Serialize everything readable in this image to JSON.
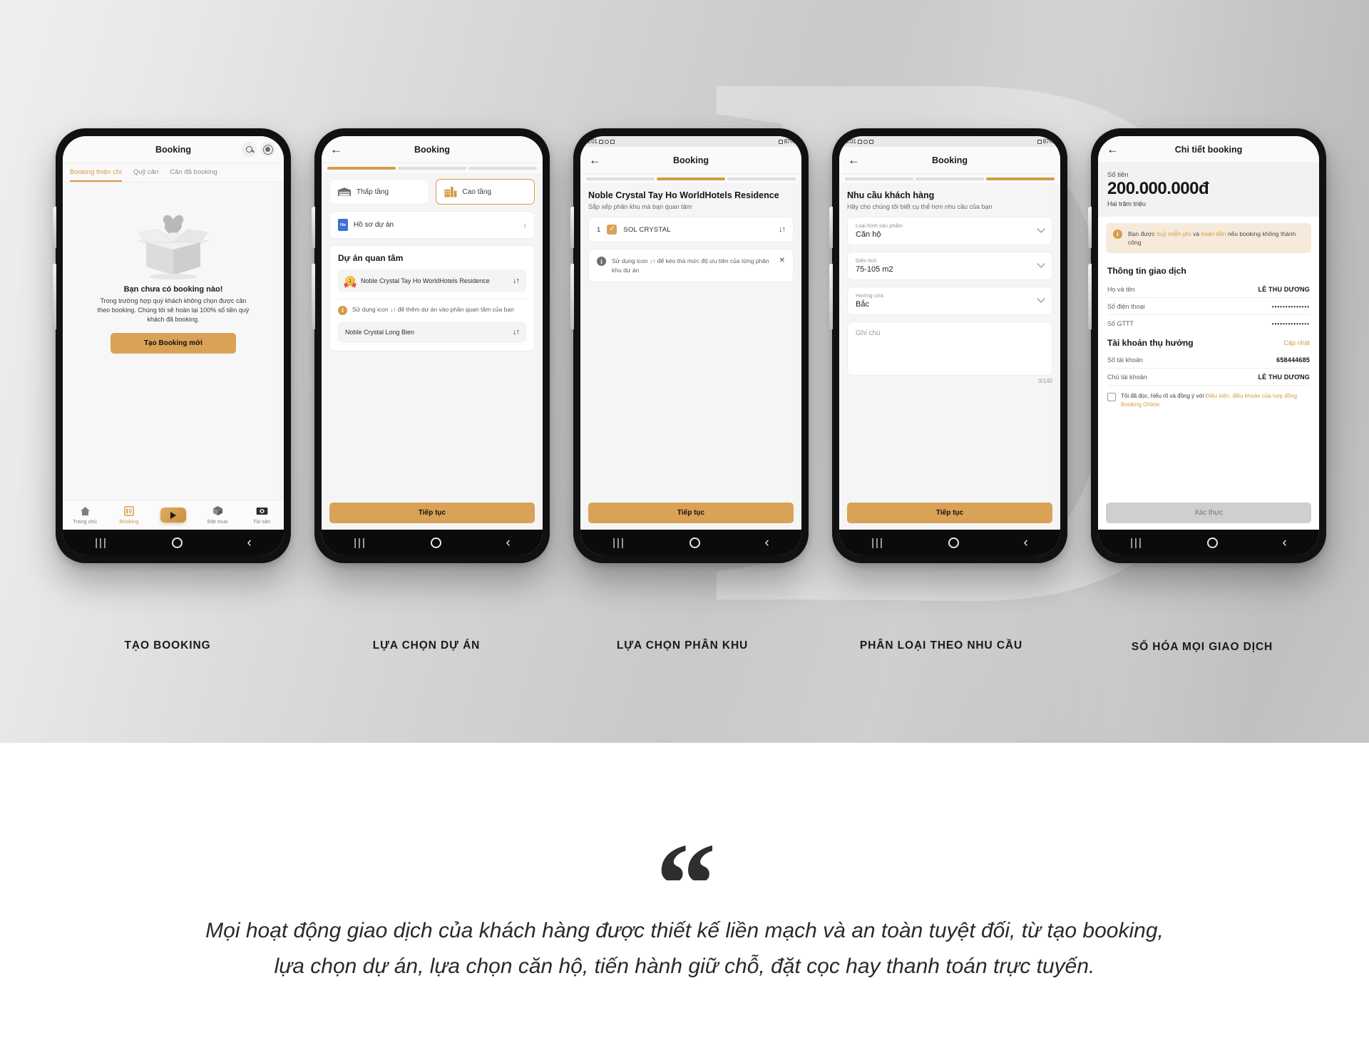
{
  "colors": {
    "accent": "#d79a46",
    "button": "#d9a257",
    "notice_bg": "#f6eadb",
    "text_dark": "#151515"
  },
  "phone1": {
    "header": {
      "title": "Booking",
      "search_icon": "search-icon",
      "avatar_icon": "avatar-icon"
    },
    "tabs": [
      {
        "label": "Booking thiện chí",
        "active": true
      },
      {
        "label": "Quỹ căn",
        "active": false
      },
      {
        "label": "Căn đã booking",
        "active": false
      }
    ],
    "empty_state": {
      "title": "Bạn chưa có booking nào!",
      "description": "Trong trường hợp quý khách không chọn được căn theo booking. Chúng tôi sẽ hoàn lại 100% số tiền quý khách đã booking.",
      "button": "Tạo Booking mới"
    },
    "bottom_nav": [
      {
        "label": "Trang chủ",
        "icon": "home-icon",
        "active": false
      },
      {
        "label": "Booking",
        "icon": "booking-icon",
        "active": true
      },
      {
        "label": "",
        "icon": "play-button-icon",
        "active": false
      },
      {
        "label": "Đặt mua",
        "icon": "package-icon",
        "active": false
      },
      {
        "label": "Tài sản",
        "icon": "money-icon",
        "active": false
      }
    ]
  },
  "phone2": {
    "header": {
      "title": "Booking",
      "back_icon": "back-arrow-icon"
    },
    "steps": {
      "total": 3,
      "current": 1
    },
    "segments": [
      {
        "label": "Thấp tầng",
        "icon": "low-rise-icon",
        "active": false
      },
      {
        "label": "Cao tầng",
        "icon": "high-rise-icon",
        "active": true
      }
    ],
    "document_row": {
      "label": "Hồ sơ dự án",
      "icon": "file-icon",
      "chevron": "chevron-right-icon"
    },
    "section_title": "Dự án quan tâm",
    "projects": [
      {
        "name": "Noble Crystal Tay Ho WorldHotels Residence",
        "badge": "1",
        "sort_icon": "sort-icon"
      },
      {
        "name": "Noble Crystal Long Bien",
        "badge": "",
        "sort_icon": "sort-icon"
      }
    ],
    "hint": "Sử dụng icon ↓↑ để thêm dự án vào phần quan tâm của bạn",
    "cta": "Tiếp tục"
  },
  "phone3": {
    "status_bar": {
      "time": "5:01",
      "battery": "87%"
    },
    "header": {
      "title": "Booking",
      "back_icon": "back-arrow-icon"
    },
    "steps": {
      "total": 3,
      "current": 2
    },
    "title": "Noble Crystal Tay Ho WorldHotels Residence",
    "subtitle": "Sắp xếp phân khu mà bạn quan tâm",
    "zones": [
      {
        "index": "1",
        "name": "SOL CRYSTAL",
        "checked": true,
        "sort_icon": "sort-icon"
      }
    ],
    "hint": "Sử dụng icon ↓↑ để kéo thả mức độ ưu tiên của từng phân khu dự án",
    "hint_close": "close-icon",
    "cta": "Tiếp tục"
  },
  "phone4": {
    "status_bar": {
      "time": "5:01",
      "battery": "87%"
    },
    "header": {
      "title": "Booking",
      "back_icon": "back-arrow-icon"
    },
    "steps": {
      "total": 3,
      "current": 3
    },
    "title": "Nhu cầu khách hàng",
    "subtitle": "Hãy cho chúng tôi biết cụ thể hơn nhu cầu của bạn",
    "fields": [
      {
        "label": "Loại hình sản phẩm",
        "value": "Căn hộ",
        "chevron": "chevron-down-icon"
      },
      {
        "label": "Diện tích",
        "value": "75-105 m2",
        "chevron": "chevron-down-icon"
      },
      {
        "label": "Hướng cửa",
        "value": "Bắc",
        "chevron": "chevron-down-icon"
      }
    ],
    "note": {
      "placeholder": "Ghi chú",
      "counter": "0/140"
    },
    "cta": "Tiếp tục"
  },
  "phone5": {
    "header": {
      "title": "Chi tiết booking",
      "back_icon": "back-arrow-icon"
    },
    "amount": {
      "label": "Số tiền",
      "value": "200.000.000đ",
      "words": "Hai trăm  triệu"
    },
    "notice": {
      "prefix": "Bạn được ",
      "link1": "huỷ miễn phí",
      "mid": " và ",
      "link2": "hoàn tiền",
      "suffix": " nếu booking không thành công"
    },
    "transaction": {
      "title": "Thông tin giao dịch",
      "rows": [
        {
          "key": "Họ và tên",
          "value": "LÊ THU DƯƠNG",
          "masked": false
        },
        {
          "key": "Số điện thoại",
          "value": "••••••••••••••",
          "masked": true
        },
        {
          "key": "Số GTTT",
          "value": "••••••••••••••",
          "masked": true
        }
      ]
    },
    "beneficiary": {
      "title": "Tài khoản thụ hưởng",
      "action": "Cập nhật",
      "rows": [
        {
          "key": "Số tài khoản",
          "value": "658444685"
        },
        {
          "key": "Chủ tài khoản",
          "value": "LÊ THU DƯƠNG"
        }
      ]
    },
    "agreement": {
      "prefix": "Tôi đã đọc, hiểu rõ và đồng ý với ",
      "link": "Điều kiện, điều khoản của hợp đồng Booking Online"
    },
    "cta": "Xác thực"
  },
  "captions": [
    "TẠO BOOKING",
    "LỰA CHỌN DỰ ÁN",
    "LỰA CHỌN PHÂN KHU",
    "PHÂN LOẠI THEO NHU CẦU",
    "SỐ HÓA MỌI GIAO DỊCH"
  ],
  "quote": {
    "mark": "“",
    "text": "Mọi hoạt động giao dịch của khách hàng được thiết kế liền mạch và an toàn tuyệt đối, từ tạo booking, lựa chọn dự án, lựa chọn căn hộ, tiến hành giữ chỗ, đặt cọc hay thanh toán trực tuyến."
  },
  "os_nav": {
    "recent": "|||",
    "home": "○",
    "back": "‹"
  }
}
